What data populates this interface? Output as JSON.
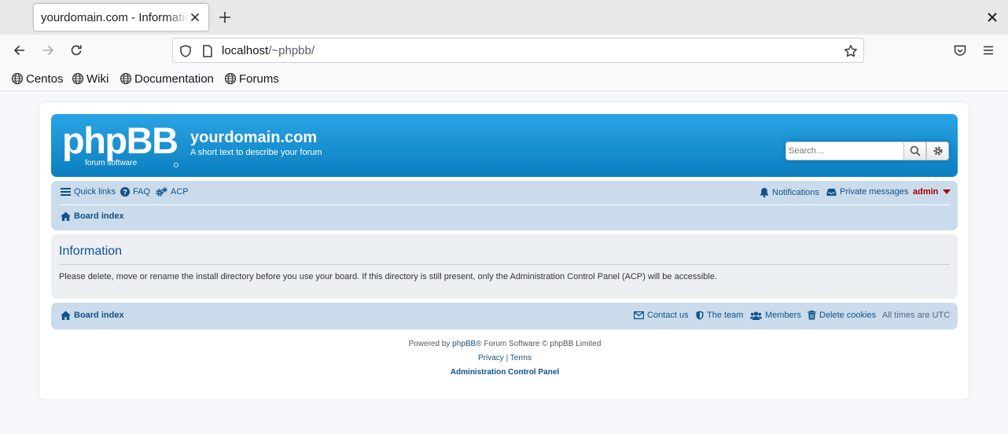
{
  "browser": {
    "tab_title": "yourdomain.com - Information",
    "url_host": "localhost",
    "url_path": "/~phpbb/",
    "bookmarks": [
      "Centos",
      "Wiki",
      "Documentation",
      "Forums"
    ]
  },
  "header": {
    "logo_text": "phpBB",
    "logo_subtext": "forum software",
    "site_title": "yourdomain.com",
    "site_description": "A short text to describe your forum",
    "search_placeholder": "Search…"
  },
  "navbar": {
    "quick_links": "Quick links",
    "faq": "FAQ",
    "acp": "ACP",
    "notifications": "Notifications",
    "private_messages": "Private messages",
    "username": "admin",
    "board_index": "Board index"
  },
  "info": {
    "title": "Information",
    "message": "Please delete, move or rename the install directory before you use your board. If this directory is still present, only the Administration Control Panel (ACP) will be accessible."
  },
  "footer_nav": {
    "board_index": "Board index",
    "contact_us": "Contact us",
    "the_team": "The team",
    "members": "Members",
    "delete_cookies": "Delete cookies",
    "timezone": "All times are UTC"
  },
  "copyright": {
    "powered_by": "Powered by",
    "phpbb_link": "phpBB",
    "rest": "® Forum Software © phpBB Limited",
    "privacy": "Privacy",
    "separator": "|",
    "terms": "Terms",
    "acp_link": "Administration Control Panel"
  },
  "colors": {
    "header_blue": "#0b7fc0",
    "nav_panel": "#cadceb",
    "link": "#105289",
    "admin": "#aa0000"
  }
}
